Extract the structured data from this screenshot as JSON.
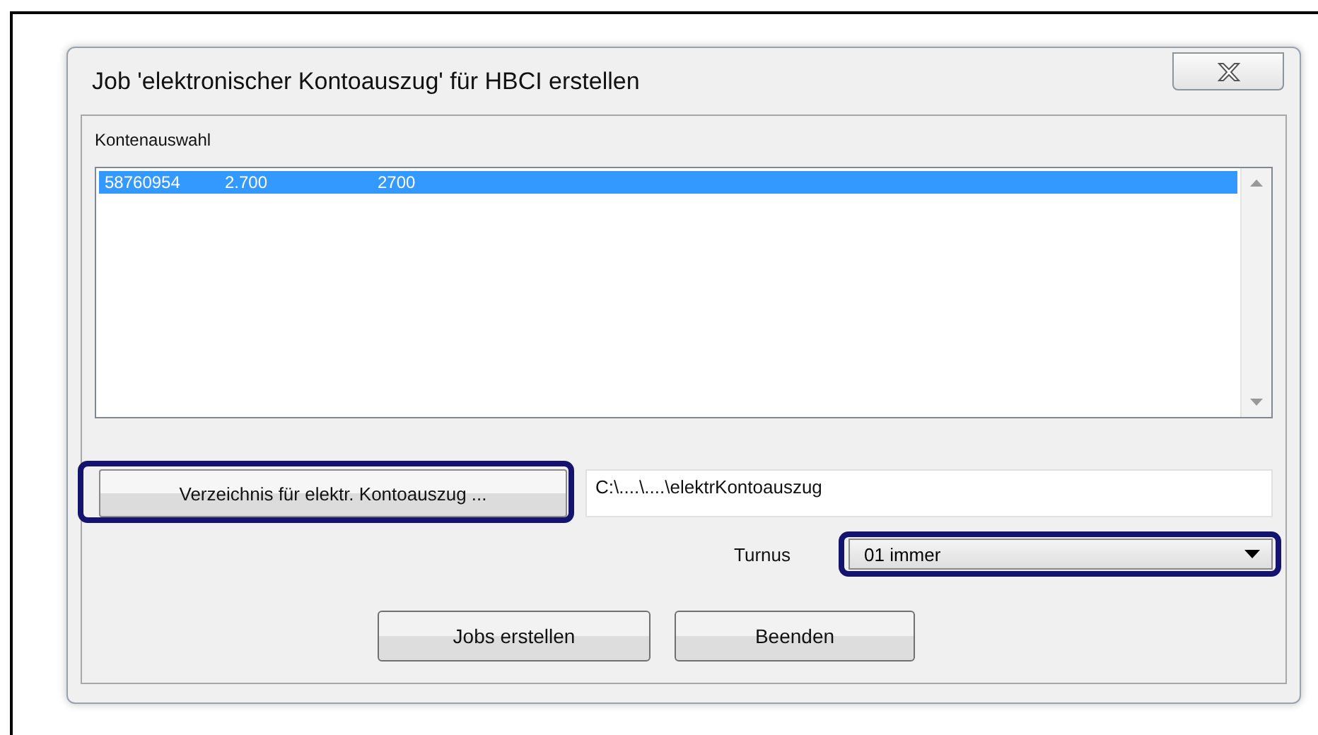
{
  "window": {
    "title": "Job 'elektronischer Kontoauszug' für HBCI erstellen"
  },
  "accounts": {
    "label": "Kontenauswahl",
    "rows": [
      {
        "cells": [
          "58760954",
          "2.700",
          "2700"
        ],
        "selected": true
      }
    ]
  },
  "directory": {
    "button": "Verzeichnis für elektr. Kontoauszug ...",
    "highlighted": true,
    "value": "C:\\....\\....\\elektrKontoauszug"
  },
  "interval": {
    "label": "Turnus",
    "value": "01 immer",
    "highlighted": true
  },
  "buttons": [
    "Jobs erstellen",
    "Beenden"
  ]
}
